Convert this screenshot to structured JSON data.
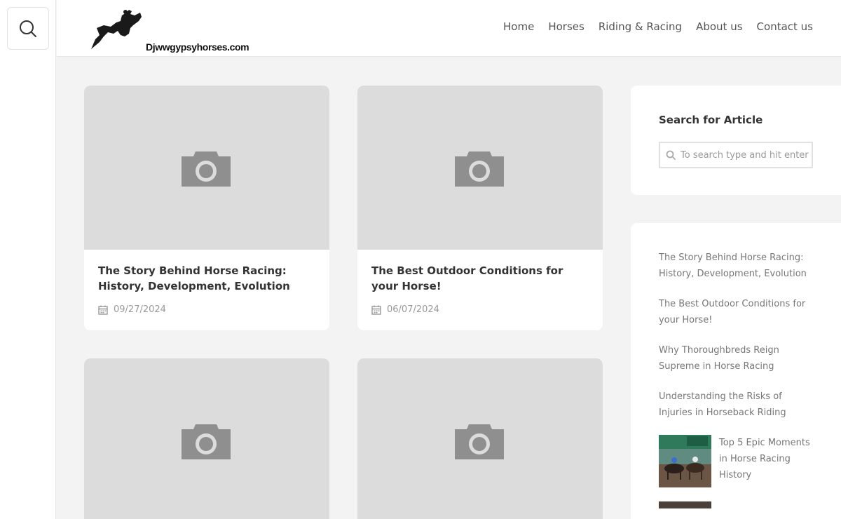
{
  "site": {
    "logo_text": "Djwwgypsyhorses.com"
  },
  "nav": {
    "items": [
      {
        "label": "Home"
      },
      {
        "label": "Horses"
      },
      {
        "label": "Riding & Racing"
      },
      {
        "label": "About us"
      },
      {
        "label": "Contact us"
      }
    ]
  },
  "posts": [
    {
      "title": "The Story Behind Horse Racing: History, Development, Evolution",
      "date": "09/27/2024"
    },
    {
      "title": "The Best Outdoor Conditions for your Horse!",
      "date": "06/07/2024"
    }
  ],
  "sidebar": {
    "search": {
      "title": "Search for Article",
      "placeholder": "To search type and hit enter"
    },
    "recent": [
      {
        "title": "The Story Behind Horse Racing: History, Development, Evolution"
      },
      {
        "title": "The Best Outdoor Conditions for your Horse!"
      },
      {
        "title": "Why Thoroughbreds Reign Supreme in Horse Racing"
      },
      {
        "title": "Understanding the Risks of Injuries in Horseback Riding"
      },
      {
        "title": "Top 5 Epic Moments in Horse Racing History"
      }
    ]
  },
  "icons": {
    "search_toggle": "search-icon",
    "thumb_placeholder": "camera-icon",
    "date": "calendar-icon",
    "search_field": "search-icon"
  },
  "colors": {
    "background": "#f3f3f3",
    "placeholder": "#dcdcdc",
    "camera": "#8f8f8f",
    "text_dark": "#333333",
    "text_muted": "#999999"
  }
}
